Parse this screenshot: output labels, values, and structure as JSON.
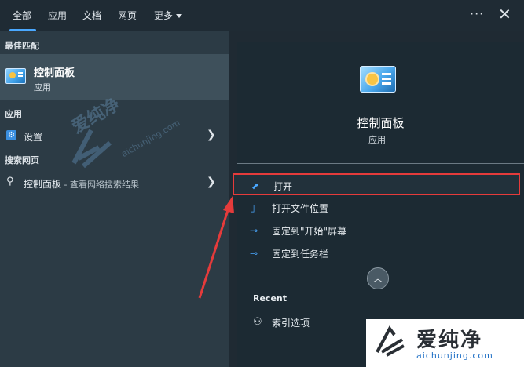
{
  "top_tabs": [
    "全部",
    "应用",
    "文档",
    "网页",
    "更多"
  ],
  "top_icons": {
    "more": "more-icon",
    "close": "close-icon"
  },
  "left": {
    "best_match_label": "最佳匹配",
    "best_match_title": "控制面板",
    "best_match_subtitle": "应用",
    "apps_label": "应用",
    "settings_label": "设置",
    "web_label": "搜索网页",
    "web_query": "控制面板",
    "web_query_suffix": " - 查看网络搜索结果"
  },
  "right": {
    "title": "控制面板",
    "subtitle": "应用",
    "actions": [
      {
        "label": "打开",
        "icon": "open-icon"
      },
      {
        "label": "打开文件位置",
        "icon": "folder-icon"
      },
      {
        "label": "固定到\"开始\"屏幕",
        "icon": "pin-icon"
      },
      {
        "label": "固定到任务栏",
        "icon": "pin-icon"
      }
    ],
    "recent_label": "Recent",
    "recent_items": [
      "索引选项"
    ]
  },
  "watermark": {
    "text": "爱纯净",
    "url": "aichunjing.com"
  },
  "colors": {
    "highlight": "#e53b3b",
    "accent": "#4aa8ff"
  }
}
